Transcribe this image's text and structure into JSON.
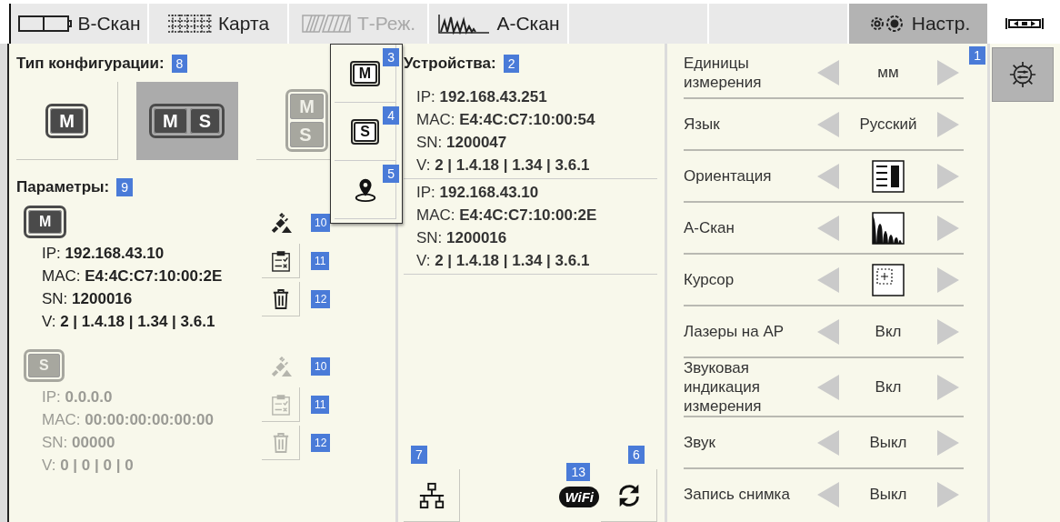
{
  "tabs": [
    {
      "label": "В-Скан",
      "kind": "bscan",
      "selected": false,
      "disabled": false
    },
    {
      "label": "Карта",
      "kind": "map",
      "selected": false,
      "disabled": false
    },
    {
      "label": "Т-Реж.",
      "kind": "tmode",
      "selected": false,
      "disabled": true
    },
    {
      "label": "А-Скан",
      "kind": "ascan",
      "selected": false,
      "disabled": false
    },
    {
      "kind": "blank",
      "selected": false
    },
    {
      "kind": "blank",
      "selected": false
    },
    {
      "label": "Настр.",
      "kind": "gears",
      "selected": true,
      "disabled": false
    }
  ],
  "config": {
    "title": "Тип конфигурации:",
    "badge": "8",
    "options": [
      {
        "kind": "single",
        "letters": [
          "M"
        ],
        "selected": false,
        "disabled": false
      },
      {
        "kind": "pair",
        "letters": [
          "M",
          "S"
        ],
        "selected": true,
        "disabled": false
      },
      {
        "kind": "stack",
        "letters": [
          "M",
          "S"
        ],
        "selected": false,
        "disabled": true
      }
    ]
  },
  "parameters": {
    "title": "Параметры:",
    "badge": "9",
    "devices": [
      {
        "letter": "M",
        "disabled": false,
        "fields": [
          {
            "label": "IP:",
            "value": "192.168.43.10"
          },
          {
            "label": "MAC:",
            "value": "E4:4C:C7:10:00:2E"
          },
          {
            "label": "SN:",
            "value": "1200016"
          },
          {
            "label": "V:",
            "value": "2 | 1.4.18 | 1.34 | 3.6.1"
          }
        ],
        "actions": [
          {
            "kind": "unplug",
            "badge": "10"
          },
          {
            "kind": "checklist",
            "badge": "11"
          },
          {
            "kind": "delete",
            "badge": "12"
          }
        ]
      },
      {
        "letter": "S",
        "disabled": true,
        "fields": [
          {
            "label": "IP:",
            "value": "0.0.0.0"
          },
          {
            "label": "MAC:",
            "value": "00:00:00:00:00:00"
          },
          {
            "label": "SN:",
            "value": "00000"
          },
          {
            "label": "V:",
            "value": "0 | 0 | 0 | 0"
          }
        ],
        "actions": [
          {
            "kind": "unplug",
            "badge": "10"
          },
          {
            "kind": "checklist",
            "badge": "11"
          },
          {
            "kind": "delete",
            "badge": "12"
          }
        ]
      }
    ]
  },
  "popup": {
    "items": [
      {
        "kind": "device",
        "letter": "M",
        "badge": "3"
      },
      {
        "kind": "device",
        "letter": "S",
        "badge": "4"
      },
      {
        "kind": "location",
        "badge": "5"
      }
    ]
  },
  "devices": {
    "title": "Устройства:",
    "badge": "2",
    "list": [
      {
        "fields": [
          {
            "label": "IP:",
            "value": "192.168.43.251"
          },
          {
            "label": "MAC:",
            "value": "E4:4C:C7:10:00:54"
          },
          {
            "label": "SN:",
            "value": "1200047"
          },
          {
            "label": "V:",
            "value": "2 | 1.4.18 | 1.34 | 3.6.1"
          }
        ]
      },
      {
        "fields": [
          {
            "label": "IP:",
            "value": "192.168.43.10"
          },
          {
            "label": "MAC:",
            "value": "E4:4C:C7:10:00:2E"
          },
          {
            "label": "SN:",
            "value": "1200016"
          },
          {
            "label": "V:",
            "value": "2 | 1.4.18 | 1.34 | 3.6.1"
          }
        ]
      }
    ],
    "network_badge": "7",
    "wifi": {
      "label": "WiFi",
      "badge": "13"
    },
    "refresh_badge": "6"
  },
  "settings": {
    "badge": "1",
    "rows": [
      {
        "label": "Единицы измерения",
        "kind": "text",
        "value": "мм"
      },
      {
        "label": "Язык",
        "kind": "text",
        "value": "Русский"
      },
      {
        "label": "Ориентация",
        "kind": "orientation"
      },
      {
        "label": "А-Скан",
        "kind": "ascan"
      },
      {
        "label": "Курсор",
        "kind": "cursor"
      },
      {
        "label": "Лазеры на АР",
        "kind": "text",
        "value": "Вкл"
      },
      {
        "label": "Звуковая индикация измерения",
        "kind": "text",
        "value": "Вкл"
      },
      {
        "label": "Звук",
        "kind": "text",
        "value": "Выкл"
      },
      {
        "label": "Запись снимка",
        "kind": "text",
        "value": "Выкл"
      }
    ]
  },
  "side": {
    "settings_button": {
      "selected": true
    }
  }
}
